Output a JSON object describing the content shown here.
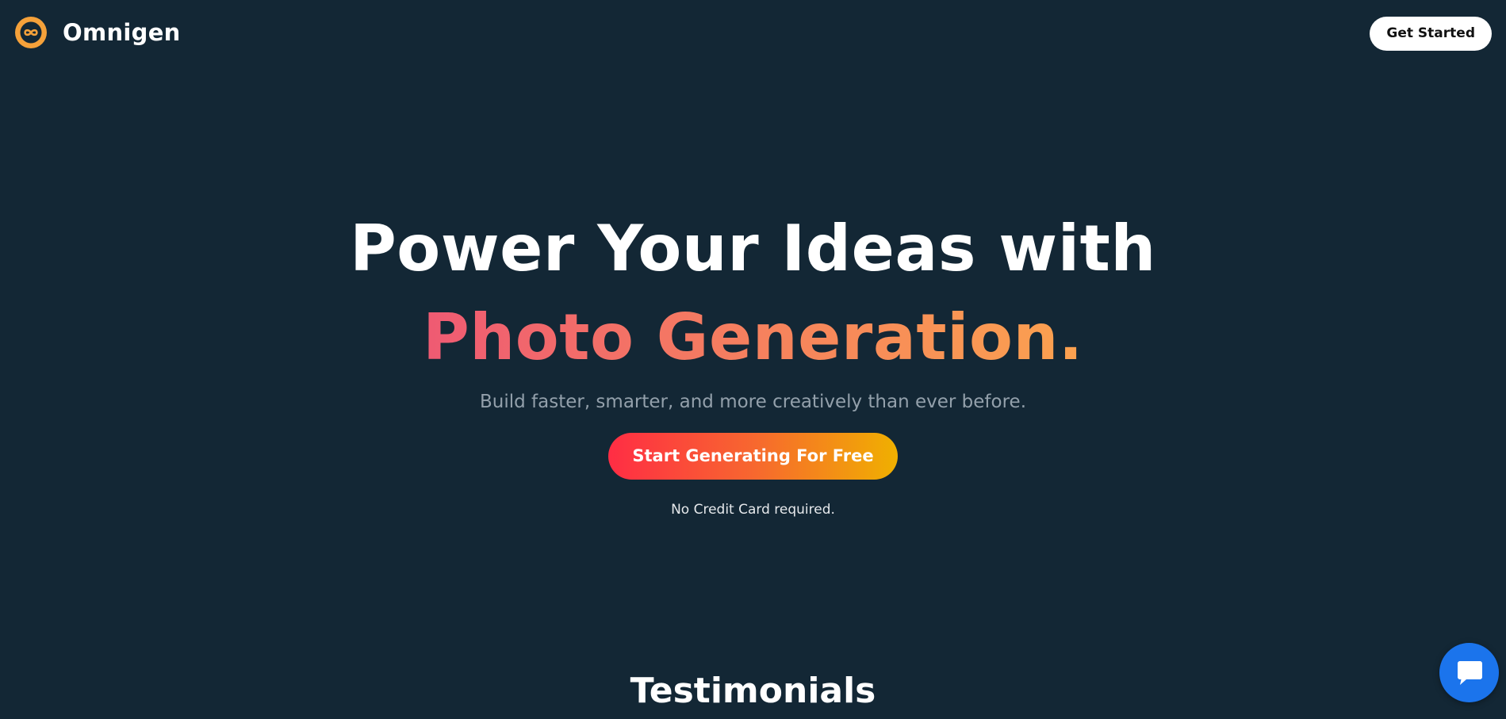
{
  "header": {
    "brand": "Omnigen",
    "logo_icon": "infinity-logo-icon",
    "get_started_label": "Get Started"
  },
  "hero": {
    "headline_line1": "Power Your Ideas with",
    "headline_line2": "Photo Generation.",
    "subtitle": "Build faster, smarter, and more creatively than ever before.",
    "cta_label": "Start Generating For Free",
    "note": "No Credit Card required."
  },
  "sections": {
    "testimonials_heading": "Testimonials"
  },
  "chat_widget": {
    "icon": "chat-bubble-icon"
  },
  "colors": {
    "background": "#132735",
    "logo_orange": "#f5a13a",
    "accent_gradient_start": "#ef5a73",
    "accent_gradient_end": "#fba24f",
    "cta_gradient_start": "#ff2d44",
    "cta_gradient_end": "#f0b000",
    "chat_blue": "#1b74ec"
  }
}
